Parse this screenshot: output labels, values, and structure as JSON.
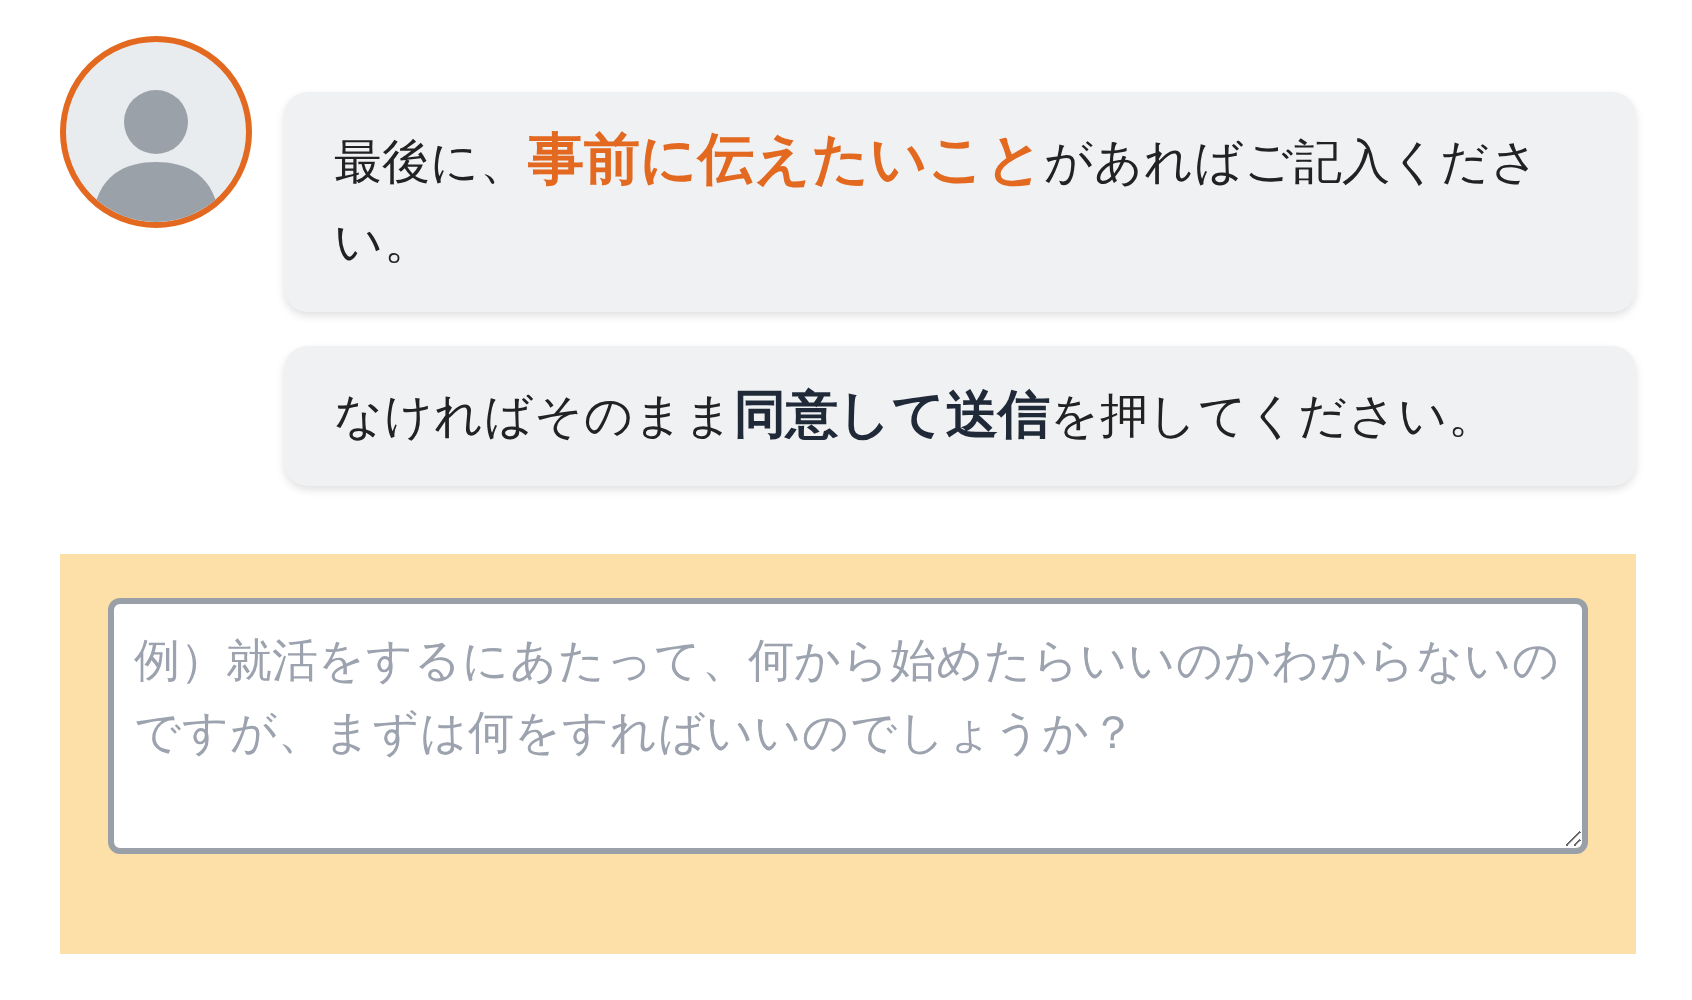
{
  "messages": [
    {
      "text": "最後に、**事前に伝えたいこと**があればご記入ください。",
      "kind": "accent"
    },
    {
      "text": "なければそのまま**同意して送信**を押してください。",
      "kind": "strong"
    }
  ],
  "answer": {
    "placeholder": "例）就活をするにあたって、何から始めたらいいのかわからないのですが、まずは何をすればいいのでしょうか？"
  }
}
